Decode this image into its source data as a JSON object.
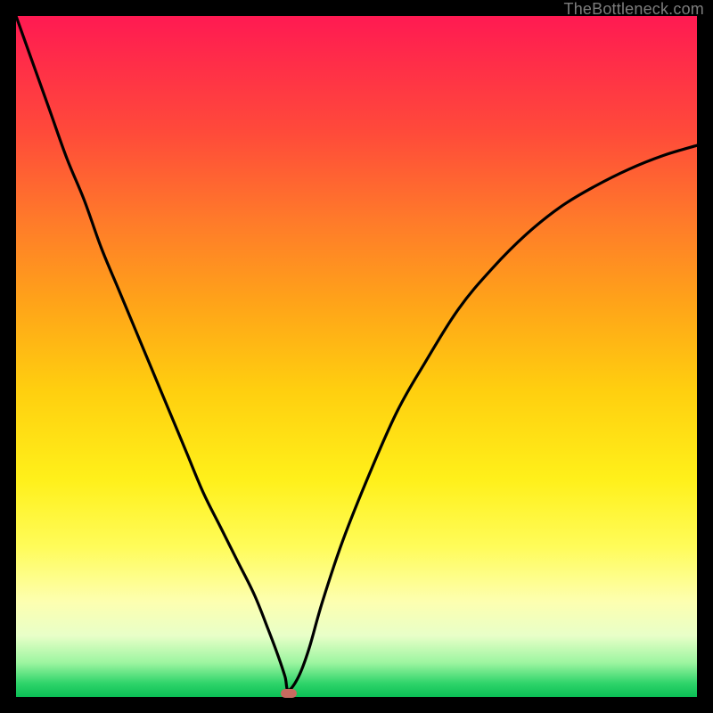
{
  "watermark": {
    "text": "TheBottleneck.com"
  },
  "colors": {
    "curve": "#000000",
    "marker": "#c96a60",
    "gradient_top": "#ff1a52",
    "gradient_bottom": "#0abf55"
  },
  "chart_data": {
    "type": "line",
    "title": "",
    "xlabel": "",
    "ylabel": "",
    "xlim": [
      0,
      100
    ],
    "ylim": [
      0,
      100
    ],
    "grid": false,
    "legend": false,
    "series": [
      {
        "name": "bottleneck-curve",
        "x": [
          0,
          2.5,
          5,
          7.5,
          10,
          12.5,
          15,
          17.5,
          20,
          22.5,
          25,
          27.5,
          30,
          32.5,
          35,
          37,
          38.5,
          39.5,
          40,
          41.5,
          43,
          45,
          48,
          52,
          56,
          60,
          65,
          70,
          75,
          80,
          85,
          90,
          95,
          100
        ],
        "y": [
          100,
          93,
          86,
          79,
          73,
          66,
          60,
          54,
          48,
          42,
          36,
          30,
          25,
          20,
          15,
          10,
          6,
          3,
          1,
          3,
          7,
          14,
          23,
          33,
          42,
          49,
          57,
          63,
          68,
          72,
          75,
          77.5,
          79.5,
          81
        ]
      }
    ],
    "marker": {
      "x": 40,
      "y": 0.5
    }
  }
}
